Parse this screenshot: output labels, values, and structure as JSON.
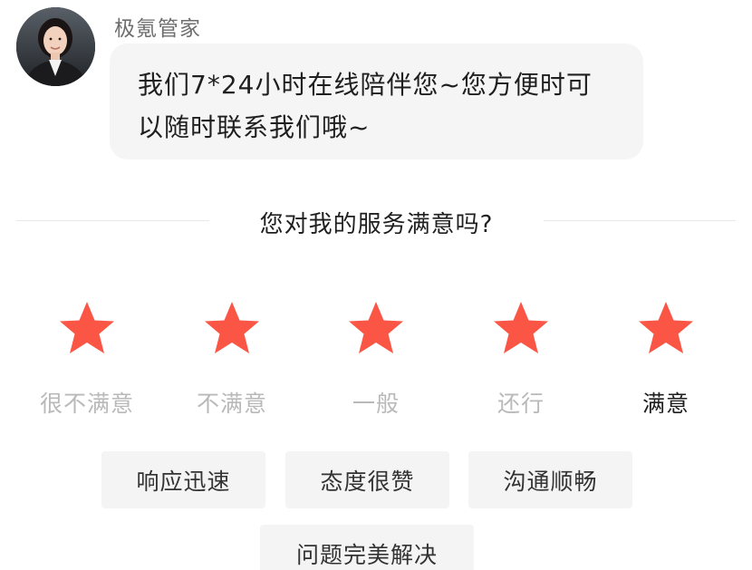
{
  "agent": {
    "name": "极氪管家",
    "avatar_icon": "agent-avatar-photo",
    "message": "我们7*24小时在线陪伴您~您方便时可以随时联系我们哦~"
  },
  "survey": {
    "question": "您对我的服务满意吗?",
    "star_color": "#fb5545",
    "selected_index": 4,
    "ratings": [
      {
        "label": "很不满意"
      },
      {
        "label": "不满意"
      },
      {
        "label": "一般"
      },
      {
        "label": "还行"
      },
      {
        "label": "满意"
      }
    ],
    "tags": [
      {
        "label": "响应迅速"
      },
      {
        "label": "态度很赞"
      },
      {
        "label": "沟通顺畅"
      },
      {
        "label": "问题完美解决"
      }
    ]
  }
}
